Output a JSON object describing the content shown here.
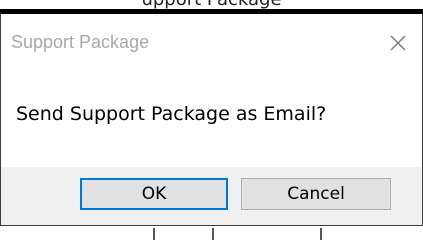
{
  "background_window": {
    "partial_title": "upport Package"
  },
  "dialog": {
    "title": "Support Package",
    "message": "Send Support Package as Email?",
    "buttons": {
      "ok_label": "OK",
      "cancel_label": "Cancel"
    },
    "close_icon": "close-icon"
  },
  "colors": {
    "title_text": "#a8a8a8",
    "footer_bg": "#f0f0f0",
    "button_bg": "#e1e1e1",
    "default_button_border": "#0078d7"
  }
}
